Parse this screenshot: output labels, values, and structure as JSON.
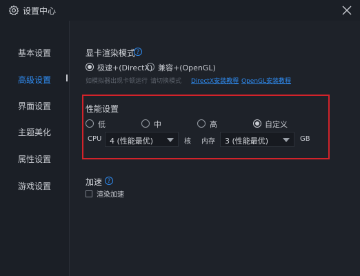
{
  "window": {
    "title": "设置中心"
  },
  "sidebar": {
    "items": [
      {
        "label": "基本设置"
      },
      {
        "label": "高级设置"
      },
      {
        "label": "界面设置"
      },
      {
        "label": "主题美化"
      },
      {
        "label": "属性设置"
      },
      {
        "label": "游戏设置"
      }
    ],
    "active_color": "#2f8cf2"
  },
  "render": {
    "title": "显卡渲染模式",
    "options": [
      {
        "label": "极速+(DirectX)",
        "checked": true
      },
      {
        "label": "兼容+(OpenGL)",
        "checked": false
      }
    ],
    "hint1": "如模拟器出现卡顿运行",
    "hint2": "请切换模式",
    "link_directx": "DirectX安装教程",
    "link_opengl": "OpenGL安装教程"
  },
  "performance": {
    "title": "性能设置",
    "options": [
      {
        "label": "低",
        "checked": false
      },
      {
        "label": "中",
        "checked": false
      },
      {
        "label": "高",
        "checked": false
      },
      {
        "label": "自定义",
        "checked": true
      }
    ],
    "cpu_label": "CPU",
    "cpu_value": "4 (性能最优)",
    "cpu_unit": "核",
    "memory_label": "内存",
    "memory_value": "3 (性能最优)",
    "memory_unit": "GB",
    "highlight_color": "#d3232a"
  },
  "acceleration": {
    "title": "加速",
    "checkbox_label": "渲染加速",
    "checked": false
  }
}
